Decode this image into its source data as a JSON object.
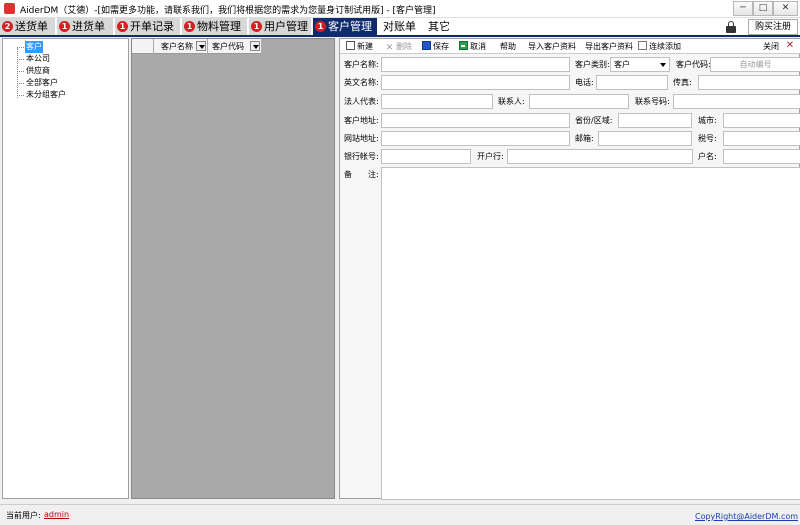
{
  "window": {
    "title": "AiderDM（艾德）-[如需更多功能，请联系我们，我们将根据您的需求为您量身订制试用版] - [客户管理]",
    "min_label": "─",
    "max_label": "□",
    "close_label": "✕"
  },
  "tabs": [
    {
      "label": "送货单",
      "badge": "2"
    },
    {
      "label": "进货单",
      "badge": "1"
    },
    {
      "label": "开单记录",
      "badge": "1"
    },
    {
      "label": "物料管理",
      "badge": "1"
    },
    {
      "label": "用户管理",
      "badge": "1"
    },
    {
      "label": "客户管理",
      "badge": "1"
    },
    {
      "label": "对账单"
    },
    {
      "label": "其它"
    }
  ],
  "header_right": {
    "buy_label": "购买注册"
  },
  "tree": {
    "items": [
      "客户",
      "本公司",
      "供应商",
      "全部客户",
      "未分组客户"
    ]
  },
  "list": {
    "columns": [
      "客户名称",
      "客户代码"
    ]
  },
  "toolbar": {
    "new": "新建",
    "delete": "删除",
    "save": "保存",
    "cancel": "取消",
    "help": "帮助",
    "import": "导入客户资料",
    "export": "导出客户资料",
    "continuous": "连续添加",
    "close": "关闭",
    "close_x": "✕"
  },
  "form": {
    "customer_name": "客户名称:",
    "customer_type": "客户类别:",
    "customer_type_value": "客户",
    "customer_code": "客户代码:",
    "customer_code_placeholder": "自动编号",
    "english_name": "英文名称:",
    "phone": "电话:",
    "fax": "传真:",
    "legal_rep": "法人代表:",
    "contact": "联系人:",
    "contact_phone": "联系号码:",
    "address": "客户地址:",
    "province": "省份/区域:",
    "city": "城市:",
    "website": "网站地址:",
    "email": "邮箱:",
    "tax_no": "税号:",
    "bank_account": "银行帐号:",
    "bank": "开户行:",
    "account_name": "户名:",
    "remark": "备　　注:"
  },
  "status": {
    "label": "当前用户:",
    "user": "admin",
    "copyright": "CopyRight@AiderDM.com"
  }
}
